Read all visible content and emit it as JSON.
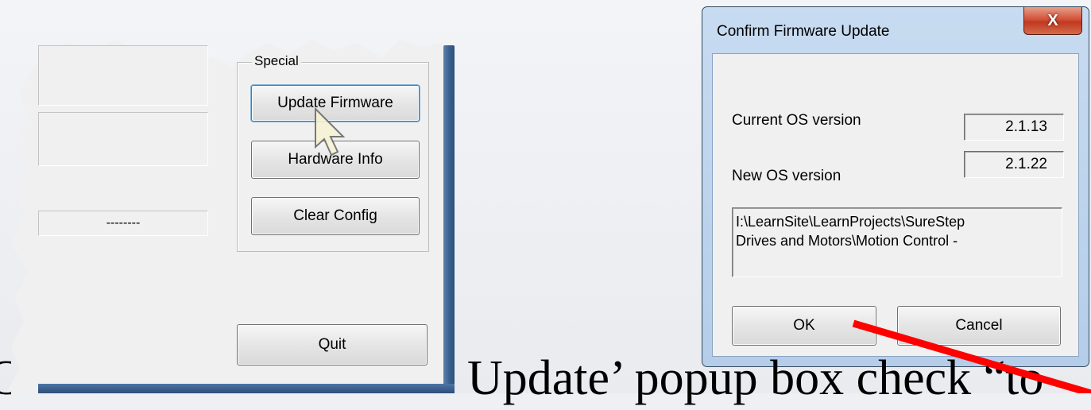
{
  "left_window": {
    "special_group_label": "Special",
    "buttons": {
      "update_firmware": "Update Firmware",
      "hardware_info": "Hardware Info",
      "clear_config": "Clear Config",
      "quit": "Quit"
    },
    "dashes_field": "--------"
  },
  "dialog": {
    "title": "Confirm Firmware Update",
    "close_glyph": "X",
    "current_os_label": "Current OS version",
    "current_os_value": "2.1.13",
    "new_os_label": "New OS version",
    "new_os_value": "2.1.22",
    "file_path": "I:\\LearnSite\\LearnProjects\\SureStep\nDrives and Motors\\Motion Control -",
    "ok_label": "OK",
    "cancel_label": "Cancel"
  },
  "caption": {
    "left_fragment": "C",
    "text": "Update’ popup box check “to"
  },
  "colors": {
    "arrow": "#ff0000",
    "window_frame": "#3b6293",
    "dialog_frame": "#b9d1ea",
    "close_button": "#c8432b"
  },
  "icons": [
    "mouse-pointer-icon",
    "close-icon"
  ]
}
